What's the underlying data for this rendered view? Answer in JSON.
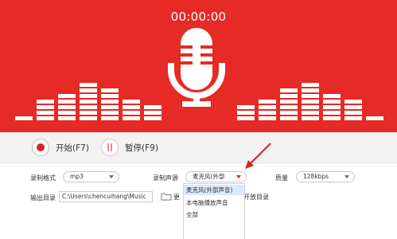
{
  "timer": "00:00:00",
  "controls": {
    "start_label": "开始(F7)",
    "pause_label": "暂停(F9)"
  },
  "settings": {
    "format_label": "录制格式",
    "format_value": "mp3",
    "source_label": "录制声源",
    "source_value": "麦克风(外部",
    "quality_label": "质量",
    "quality_value": "128kbps",
    "output_label": "输出目录",
    "output_path": "C:\\Users\\chencuihang\\Music",
    "change_label": "更",
    "open_label": "打开",
    "partial_right": "开放目录"
  },
  "dropdown": {
    "options": [
      "麦克风(外部声音)",
      "本电脑播放声音",
      "全部"
    ],
    "selected_index": 0
  },
  "colors": {
    "accent": "#e62a26",
    "arrow": "#d9231f"
  }
}
